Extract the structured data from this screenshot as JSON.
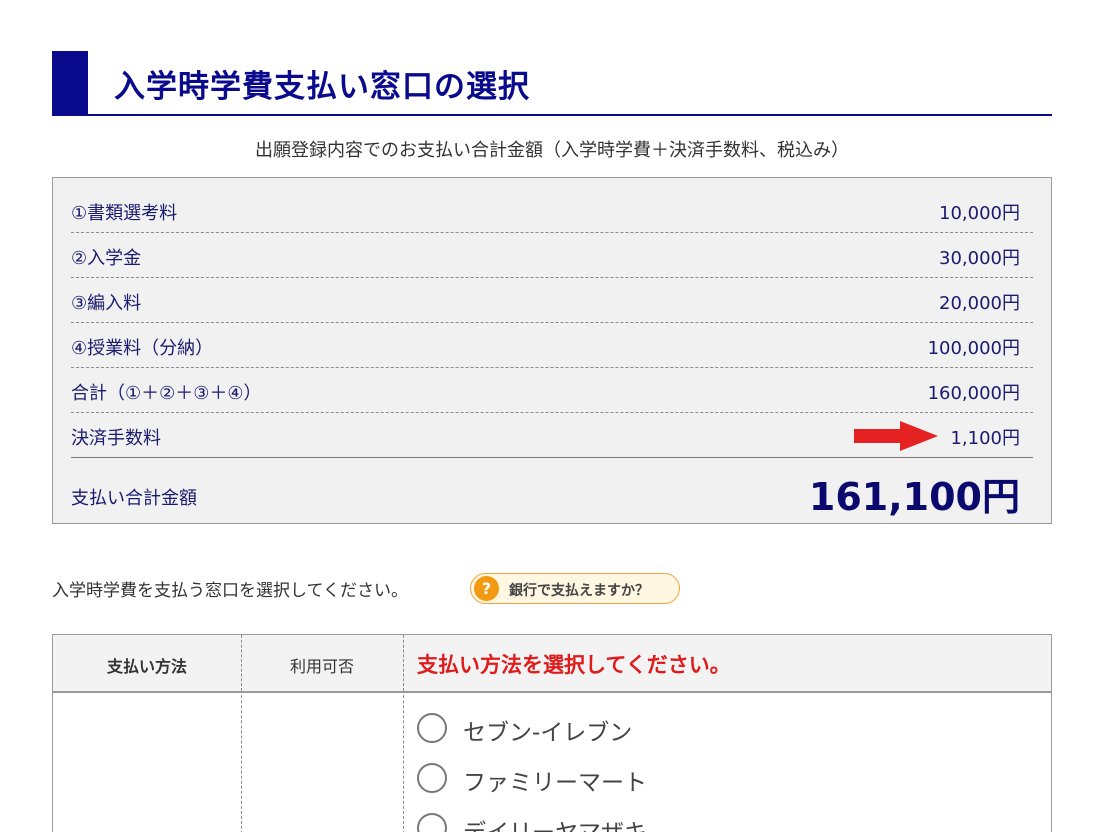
{
  "title": "入学時学費支払い窓口の選択",
  "subtitle": "出願登録内容でのお支払い合計金額（入学時学費＋決済手数料、税込み）",
  "fees": [
    {
      "label": "①書類選考料",
      "amount": "10,000円"
    },
    {
      "label": "②入学金",
      "amount": "30,000円"
    },
    {
      "label": "③編入料",
      "amount": "20,000円"
    },
    {
      "label": "④授業料（分納）",
      "amount": "100,000円"
    },
    {
      "label": "合計（①＋②＋③＋④）",
      "amount": "160,000円"
    },
    {
      "label": "決済手数料",
      "amount": "1,100円"
    }
  ],
  "total": {
    "label": "支払い合計金額",
    "amount": "161,100円"
  },
  "instruction": "入学時学費を支払う窓口を選択してください。",
  "bank_button": {
    "icon": "?",
    "label": "銀行で支払えますか？"
  },
  "payment_table": {
    "headers": {
      "method": "支払い方法",
      "availability": "利用可否",
      "select_prompt": "支払い方法を選択してください。"
    },
    "options": [
      "セブン-イレブン",
      "ファミリーマート",
      "デイリーヤマザキ"
    ]
  },
  "colors": {
    "title_navy": "#0a0a8c",
    "prompt_red": "#e01b1b",
    "arrow_red": "#e52222",
    "badge_orange": "#f39a12"
  }
}
